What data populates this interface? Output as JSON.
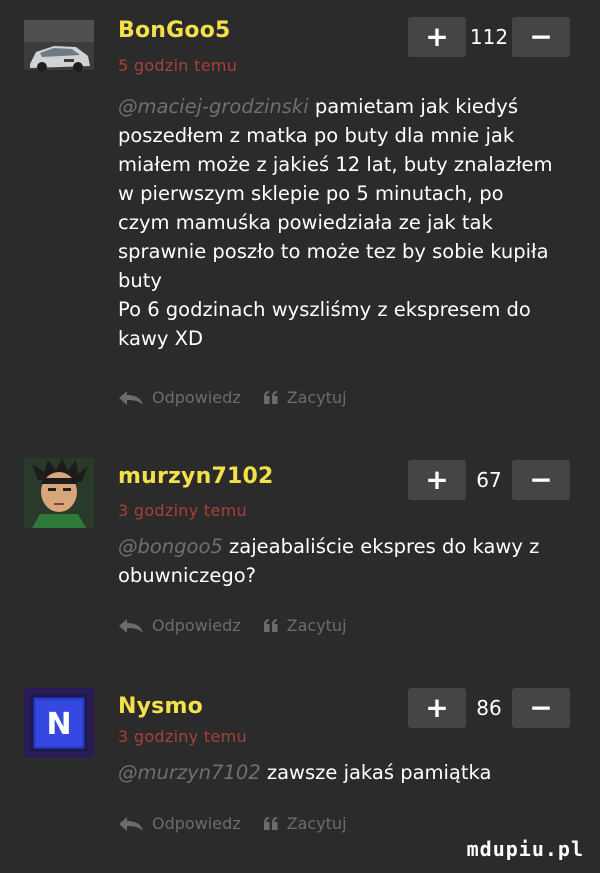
{
  "comments": [
    {
      "username": "BonGoo5",
      "time": "5 godzin temu",
      "score": "112",
      "mention": "@maciej-grodzinski",
      "text_lines": [
        "pamietam jak kiedyś",
        "poszedłem z matka po buty dla mnie jak",
        "miałem może z jakieś 12 lat, buty znalazłem",
        "w pierwszym sklepie po 5 minutach, po",
        "czym mamuśka powiedziała ze jak tak",
        "sprawnie poszło to może tez by sobie kupiła",
        "buty",
        "Po 6 godzinach wyszliśmy z ekspresem do",
        "kawy XD"
      ],
      "reply_label": "Odpowiedz",
      "quote_label": "Zacytuj"
    },
    {
      "username": "murzyn7102",
      "time": "3 godziny temu",
      "score": "67",
      "mention": "@bongoo5",
      "text_lines": [
        "zajeabaliście ekspres do kawy z",
        "obuwniczego?"
      ],
      "reply_label": "Odpowiedz",
      "quote_label": "Zacytuj"
    },
    {
      "username": "Nysmo",
      "time": "3 godziny temu",
      "score": "86",
      "mention": "@murzyn7102",
      "text_lines": [
        "zawsze jakaś pamiątka"
      ],
      "reply_label": "Odpowiedz",
      "quote_label": "Zacytuj"
    }
  ],
  "vote": {
    "plus": "+",
    "minus": "−"
  },
  "avatar3_letter": "N",
  "watermark": "mdupiu.pl",
  "colors": {
    "background": "#2b2b2b",
    "username": "#f3e14a",
    "timestamp": "#a8403c",
    "mention": "#6f6f6f",
    "action": "#6c6c6c",
    "vote_button": "#454545"
  }
}
